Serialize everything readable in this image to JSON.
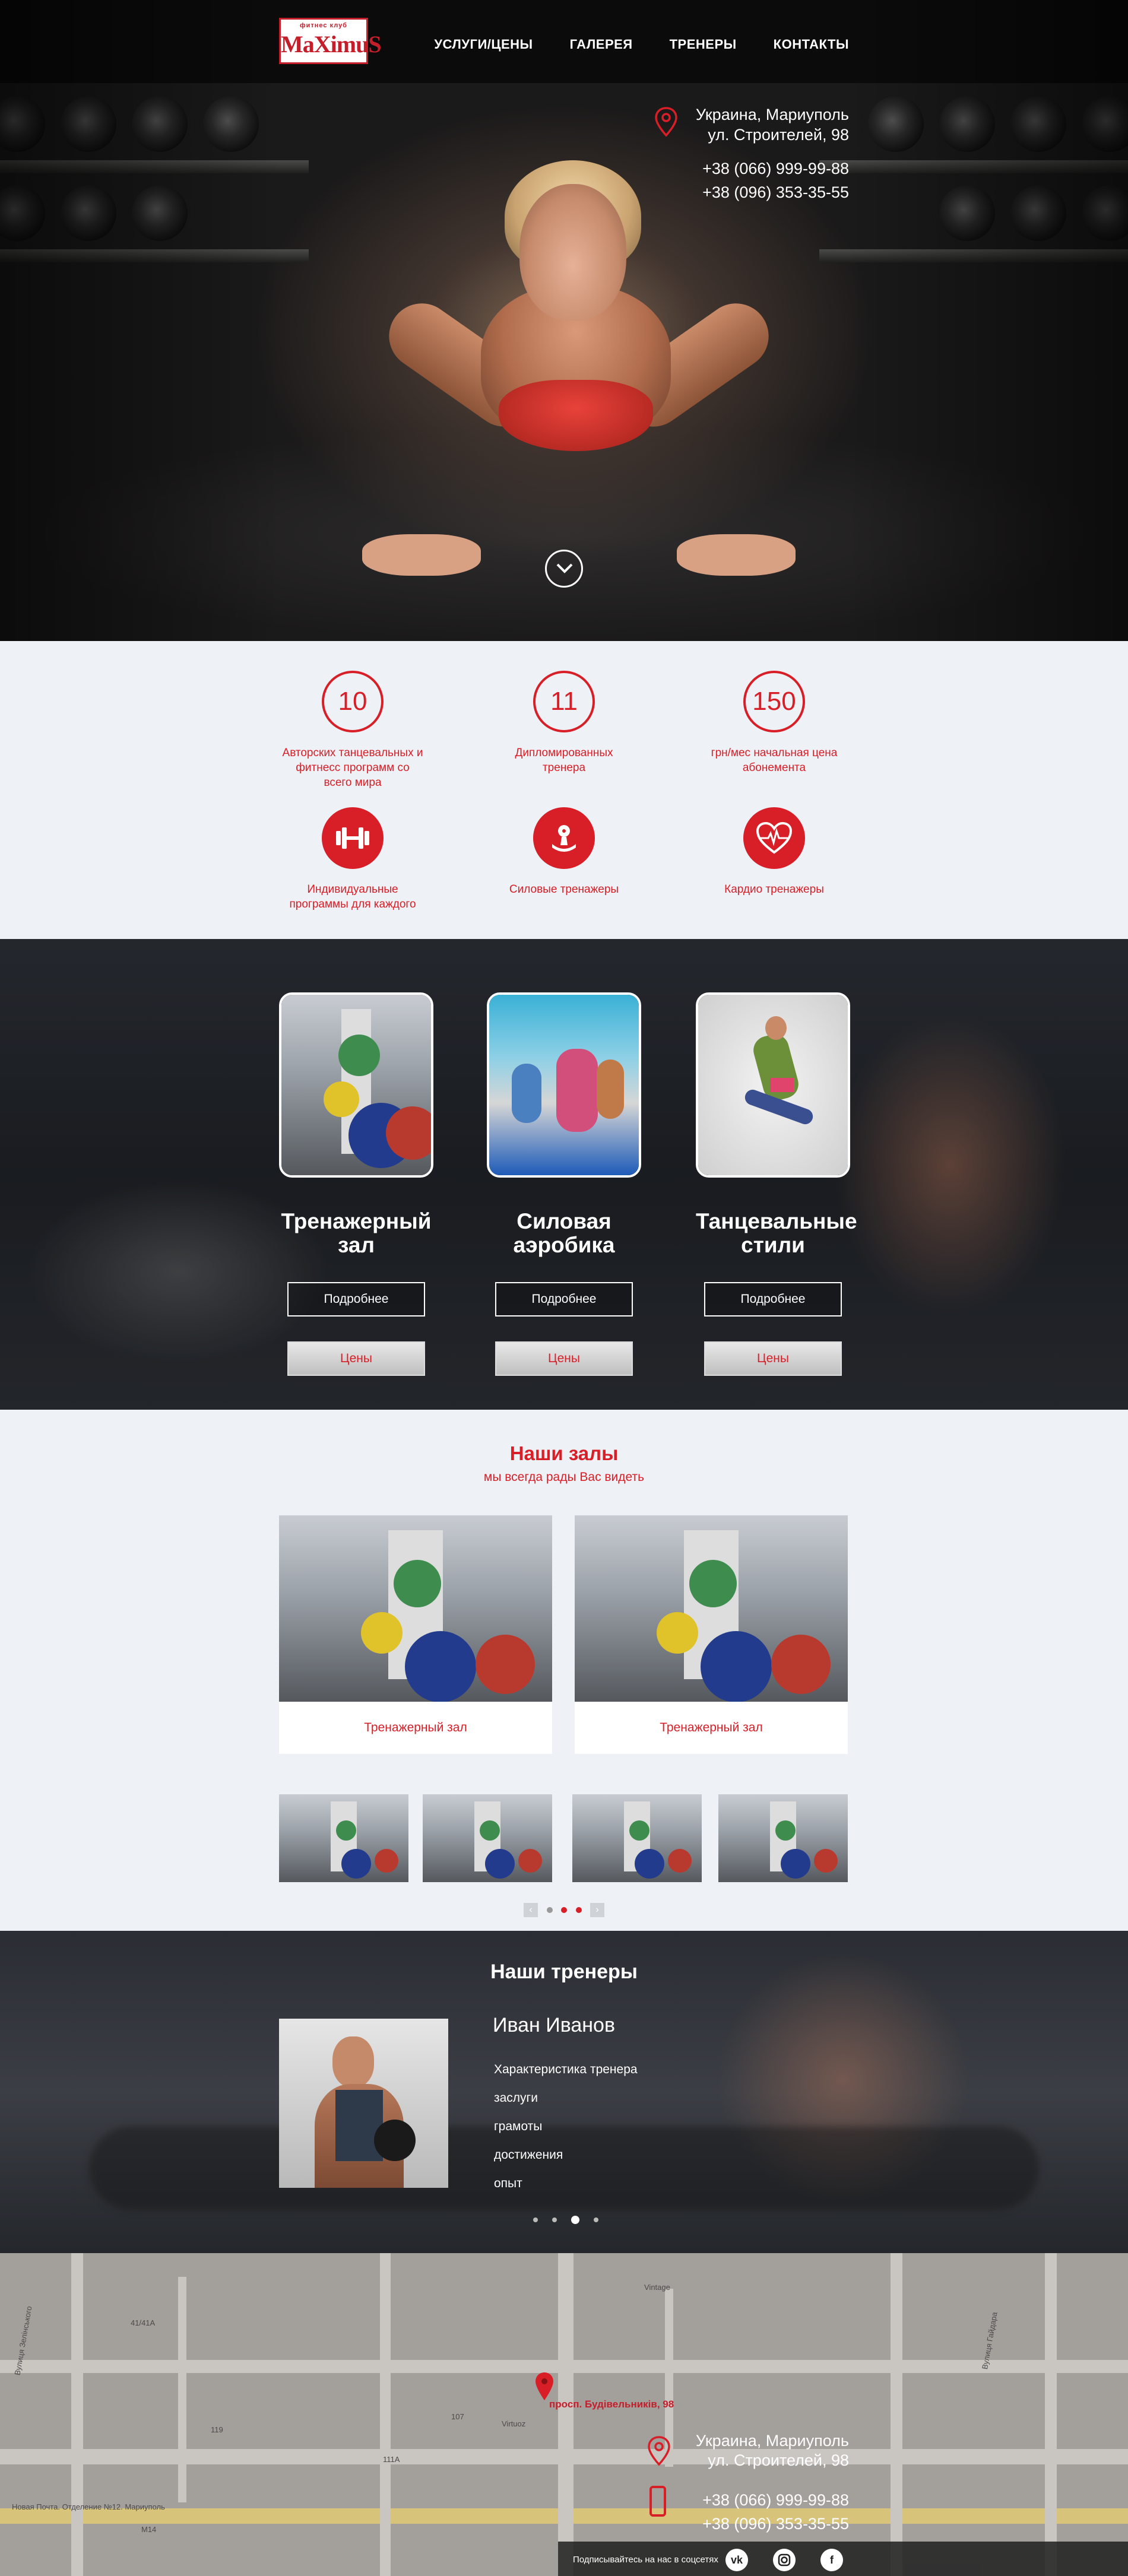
{
  "header": {
    "logo_small": "фитнес клуб",
    "logo_big": "MaXimuS",
    "nav": [
      "УСЛУГИ/ЦЕНЫ",
      "ГАЛЕРЕЯ",
      "ТРЕНЕРЫ",
      "КОНТАКТЫ"
    ]
  },
  "contact": {
    "address_line1": "Украина, Мариуполь",
    "address_line2": "ул. Строителей, 98",
    "phone1": "+38 (066) 999-99-88",
    "phone2": "+38 (096) 353-35-55"
  },
  "features": [
    {
      "value": "10",
      "text": "Авторских танцевальных и фитнесс программ со всего мира"
    },
    {
      "value": "11",
      "text": "Дипломированных тренера"
    },
    {
      "value": "150",
      "text": "грн/мес начальная цена абонемента"
    },
    {
      "icon": "dumbbell-icon",
      "text": "Индивидуальные программы для каждого"
    },
    {
      "icon": "strength-icon",
      "text": "Силовые тренажеры"
    },
    {
      "icon": "heart-icon",
      "text": "Кардио тренажеры"
    }
  ],
  "services": [
    {
      "title": "Тренажерный зал",
      "more": "Подробнее",
      "price": "Цены"
    },
    {
      "title": "Силовая аэробика",
      "more": "Подробнее",
      "price": "Цены"
    },
    {
      "title": "Танцевальные стили",
      "more": "Подробнее",
      "price": "Цены"
    }
  ],
  "halls": {
    "title": "Наши залы",
    "subtitle": "мы всегда рады Вас видеть",
    "cards": [
      "Тренажерный зал",
      "Тренажерный зал"
    ]
  },
  "trainers": {
    "title": "Наши тренеры",
    "name": "Иван Иванов",
    "items": [
      "Характеристика тренера",
      "заслуги",
      "грамоты",
      "достижения",
      "опыт"
    ]
  },
  "map": {
    "pin_label": "просп. Будівельників, 98",
    "labels": [
      "Новая Почта. Отделение №12. Мариуполь",
      "Virtuoz",
      "Vintage",
      "M14",
      "119",
      "111A",
      "107",
      "41/41A",
      "Вулиця Гайдара",
      "Вулиця Зелінського"
    ]
  },
  "footer": {
    "subscribe": "Подписывайтесь на нас в соцсетях",
    "social": [
      "vk-icon",
      "instagram-icon",
      "facebook-icon"
    ]
  },
  "colors": {
    "accent": "#d81e27",
    "dark": "#1e2126"
  }
}
